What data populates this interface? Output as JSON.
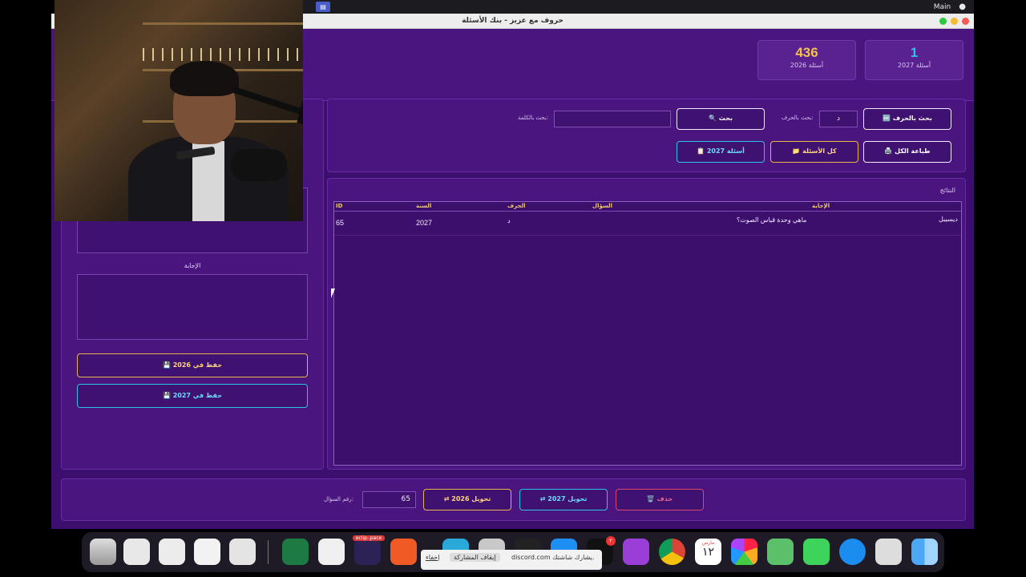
{
  "menubar": {
    "user": "Main",
    "apple": ""
  },
  "window": {
    "title": "حروف مع عزيز - بنك الأسئلة"
  },
  "stats": [
    {
      "count": "1",
      "label": "أسئلة 2027",
      "color": "#2bc3e8"
    },
    {
      "count": "436",
      "label": "أسئلة 2026",
      "color": "#f2c14e"
    }
  ],
  "search": {
    "letter_search_btn": "🔤 بحث بالحرف",
    "letter_label": "بحث بالحرف:",
    "letter_value": "د",
    "search_btn": "🔍 بحث",
    "word_label": "بحث بالكلمة:",
    "word_value": "",
    "print_all_btn": "🖨️ طباعة الكل",
    "all_questions_btn": "📁 كل الأسئلة",
    "q2027_btn": "📋 أسئلة 2027"
  },
  "results": {
    "title": "النتائج",
    "columns": [
      "ID",
      "السنة",
      "الحرف",
      "السؤال",
      "الإجابة"
    ],
    "rows": [
      {
        "id": "65",
        "year": "2027",
        "letter": "د",
        "question": "ماهي وحدة قياس الصوت؟",
        "answer": "ديسيبل"
      }
    ]
  },
  "left_panel": {
    "answer_label": "الإجابة",
    "save_2026": "💾 حفظ في 2026",
    "save_2027": "💾 حفظ في 2027"
  },
  "bottom": {
    "delete_btn": "🗑️ حذف",
    "move_2027_btn": "⇄ تحويل 2027",
    "move_2026_btn": "⇄ تحويل 2026",
    "qnum_value": "65",
    "qnum_label": "رقم السؤال:"
  },
  "share_bar": {
    "text": "discord.com يشارك شاشتك.",
    "stop": "إيقاف المشاركة",
    "hide": "إخفاء"
  },
  "dock": {
    "calendar_month": "مارس",
    "calendar_day": "١٢",
    "eclipse_label": "eclip..pace",
    "badge": "٢"
  },
  "colors": {
    "bg": "#3c0f6e",
    "panel": "#4b157f",
    "gold": "#e6b64a",
    "cyan": "#2bc3e8",
    "red": "#d9466f"
  }
}
